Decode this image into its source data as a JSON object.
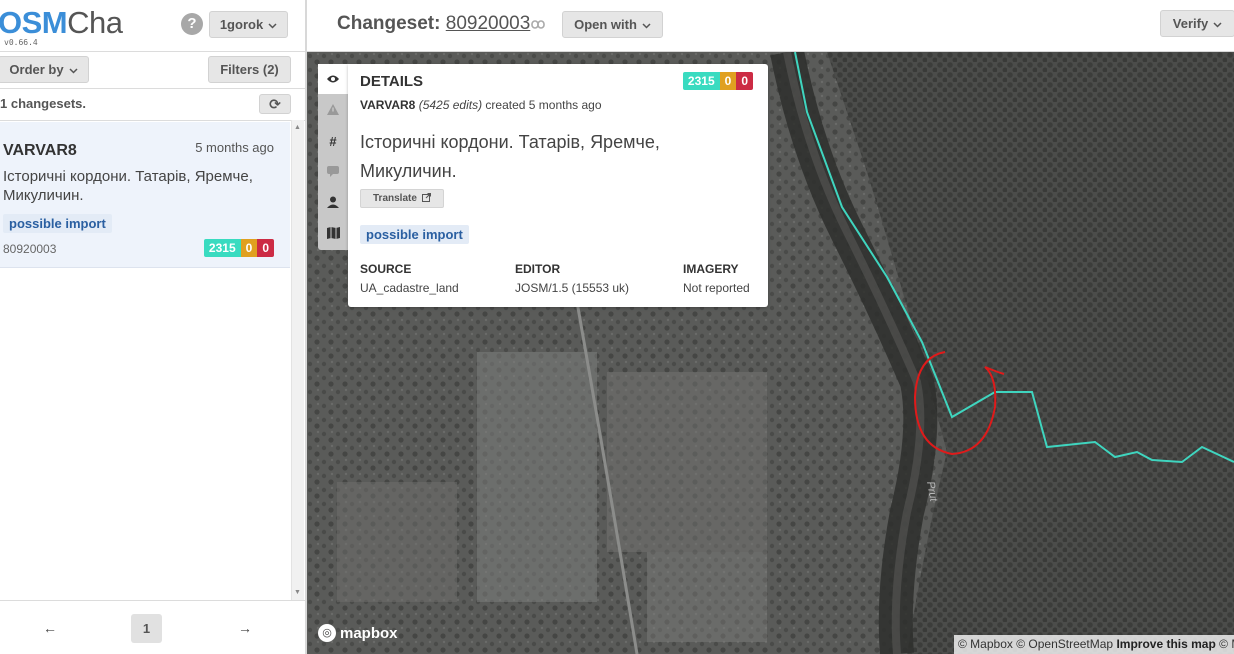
{
  "app": {
    "logo_osm": "OSM",
    "logo_cha": "Cha",
    "version": "v0.66.4",
    "help_glyph": "?",
    "user_button": "1gorok"
  },
  "sidebar": {
    "order_by": "Order by",
    "filters": "Filters (2)",
    "count_text": "1 changesets.",
    "refresh_glyph": "⟳",
    "changesets": [
      {
        "user": "VARVAR8",
        "time": "5 months ago",
        "comment": "Історичні кордони. Татарів, Яремче, Микуличин.",
        "tag": "possible import",
        "id": "80920003",
        "added": "2315",
        "modified": "0",
        "deleted": "0"
      }
    ],
    "pagination": {
      "prev": "←",
      "page": "1",
      "next": "→"
    }
  },
  "header": {
    "changeset_label": "Changeset:",
    "changeset_id": "80920003",
    "open_with": "Open with",
    "verify": "Verify"
  },
  "details": {
    "title": "DETAILS",
    "user": "VARVAR8",
    "edits": "(5425 edits)",
    "created": "created 5 months ago",
    "comment": "Історичні кордони. Татарів, Яремче, Микуличин.",
    "translate": "Translate",
    "tag": "possible import",
    "counts": {
      "added": "2315",
      "modified": "0",
      "deleted": "0"
    },
    "source_label": "SOURCE",
    "source_value": "UA_cadastre_land",
    "editor_label": "EDITOR",
    "editor_value": "JOSM/1.5 (15553 uk)",
    "imagery_label": "IMAGERY",
    "imagery_value": "Not reported"
  },
  "map": {
    "river_label": "Prut",
    "mapbox_logo": "mapbox",
    "attribution_mapbox": "© Mapbox",
    "attribution_osm": "© OpenStreetMap",
    "attribution_improve": "Improve this map",
    "attribution_tail": "© M",
    "boundary_color": "#3fd5bf",
    "annotation_color": "#e01a1a"
  },
  "colors": {
    "accent": "#3b8ed8",
    "added": "#39dbc0",
    "modified": "#e0a020",
    "deleted": "#cc2b44",
    "tag_text": "#2a5fa1",
    "tag_bg": "#e3ebf6"
  }
}
